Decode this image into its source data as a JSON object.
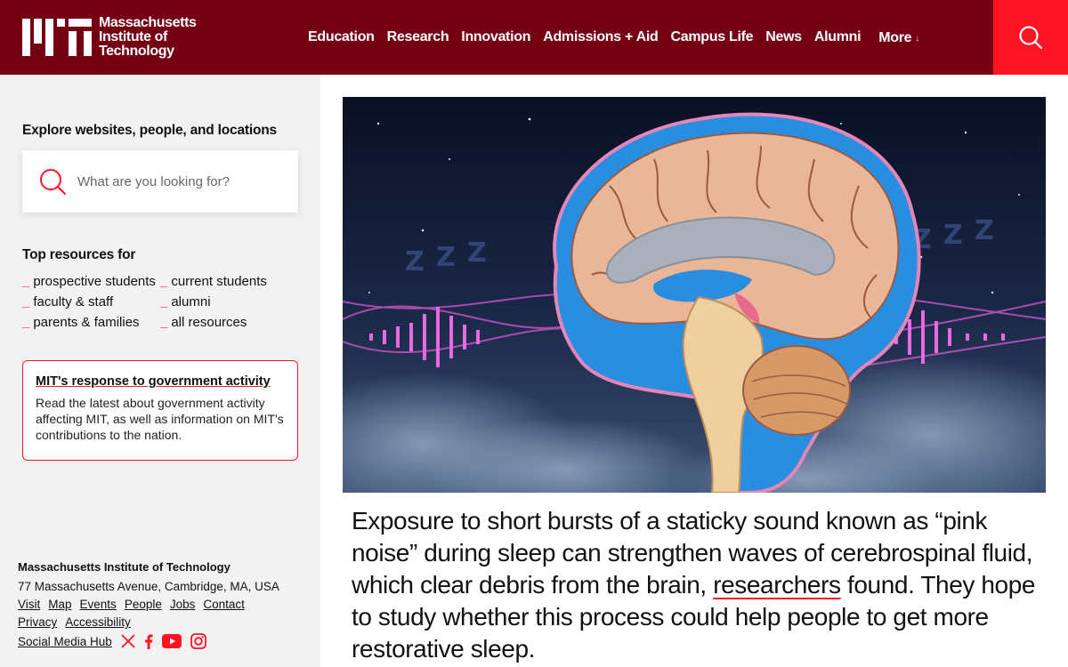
{
  "header": {
    "logo_lines": [
      "Massachusetts",
      "Institute of",
      "Technology"
    ],
    "nav": [
      "Education",
      "Research",
      "Innovation",
      "Admissions + Aid",
      "Campus Life",
      "News",
      "Alumni"
    ],
    "more_label": "More",
    "more_arrow": "↓",
    "brand_color": "#750014",
    "accent_color": "#ff1423"
  },
  "sidebar": {
    "explore_title": "Explore websites, people, and locations",
    "search_placeholder": "What are you looking for?",
    "resources_title": "Top resources for",
    "resources": [
      "prospective students",
      "current students",
      "faculty & staff",
      "alumni",
      "parents & families",
      "all resources"
    ],
    "notice": {
      "title": "MIT's response to government activity",
      "body": "Read the latest about government activity affecting MIT, as well as information on MIT's contributions to the nation."
    },
    "footer": {
      "name": "Massachusetts Institute of Technology",
      "address": "77 Massachusetts Avenue, Cambridge, MA, USA",
      "links_row1": [
        "Visit",
        "Map",
        "Events",
        "People",
        "Jobs",
        "Contact"
      ],
      "links_row2": [
        "Privacy",
        "Accessibility"
      ],
      "social_hub": "Social Media Hub",
      "social_icons": [
        "x-icon",
        "facebook-icon",
        "youtube-icon",
        "instagram-icon"
      ]
    }
  },
  "main": {
    "hero_alt": "brain illustration",
    "caption_before": "Exposure to short bursts of a staticky sound known as “pink noise” during sleep can strengthen waves of cerebrospinal fluid, which clear debris from the brain, ",
    "caption_link": "researchers",
    "caption_after": " found. They hope to study whether this process could help people to get more restorative sleep."
  }
}
